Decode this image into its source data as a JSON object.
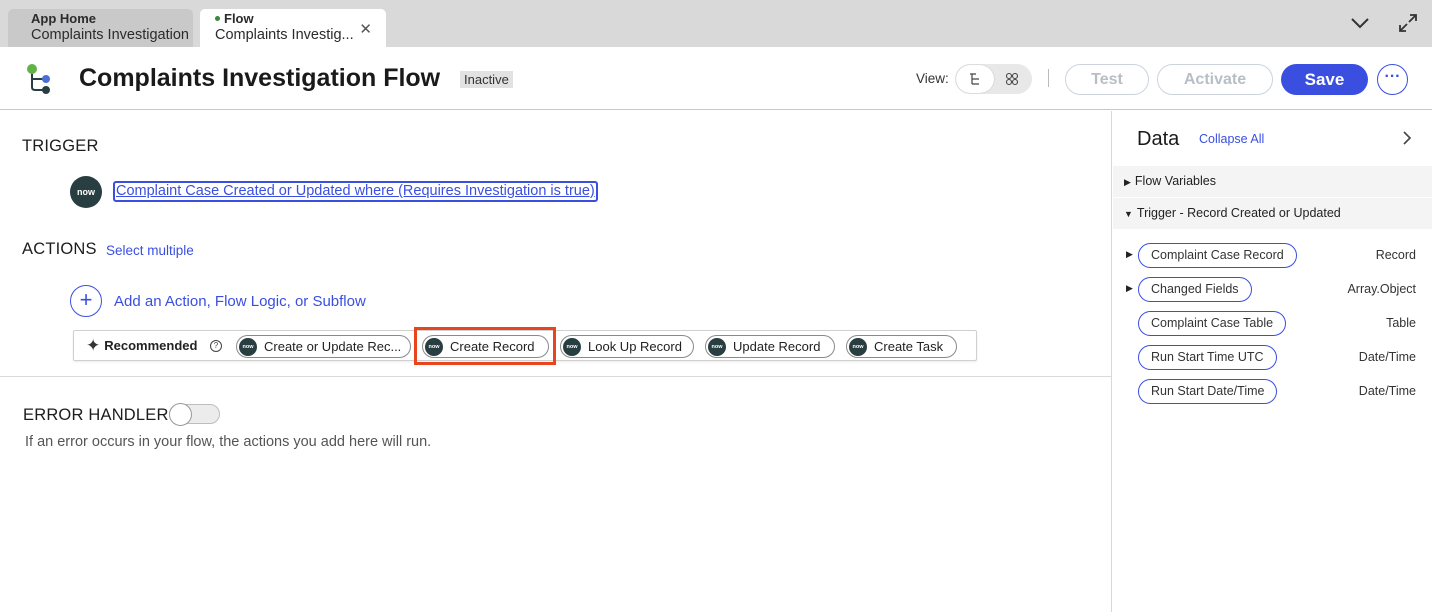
{
  "tabs": [
    {
      "label": "App Home",
      "title": "Complaints Investigation"
    },
    {
      "label": "Flow",
      "title": "Complaints Investig..."
    }
  ],
  "header": {
    "title": "Complaints Investigation Flow",
    "status_badge": "Inactive",
    "view_label": "View:",
    "test_label": "Test",
    "activate_label": "Activate",
    "save_label": "Save",
    "more_label": "···"
  },
  "trigger": {
    "section_title": "TRIGGER",
    "logo_text": "now",
    "description": "Complaint Case Created or Updated where (Requires Investigation is true)"
  },
  "actions": {
    "section_title": "ACTIONS",
    "select_multiple": "Select multiple",
    "add_label": "Add an Action, Flow Logic, or Subflow",
    "recommended_label": "Recommended",
    "recommended": [
      "Create or Update Rec...",
      "Create Record",
      "Look Up Record",
      "Update Record",
      "Create Task"
    ]
  },
  "error_handler": {
    "title": "ERROR HANDLER",
    "enabled": false,
    "description": "If an error occurs in your flow, the actions you add here will run."
  },
  "data_panel": {
    "title": "Data",
    "collapse_all": "Collapse All",
    "sections": [
      "Flow Variables",
      "Trigger - Record Created or Updated"
    ],
    "variables": [
      {
        "name": "Complaint Case Record",
        "type": "Record",
        "expandable": true
      },
      {
        "name": "Changed Fields",
        "type": "Array.Object",
        "expandable": true
      },
      {
        "name": "Complaint Case Table",
        "type": "Table",
        "expandable": false
      },
      {
        "name": "Run Start Time UTC",
        "type": "Date/Time",
        "expandable": false
      },
      {
        "name": "Run Start Date/Time",
        "type": "Date/Time",
        "expandable": false
      }
    ]
  },
  "colors": {
    "accent": "#3a4fe0",
    "highlight": "#e8441e",
    "now_badge": "#293e40"
  }
}
